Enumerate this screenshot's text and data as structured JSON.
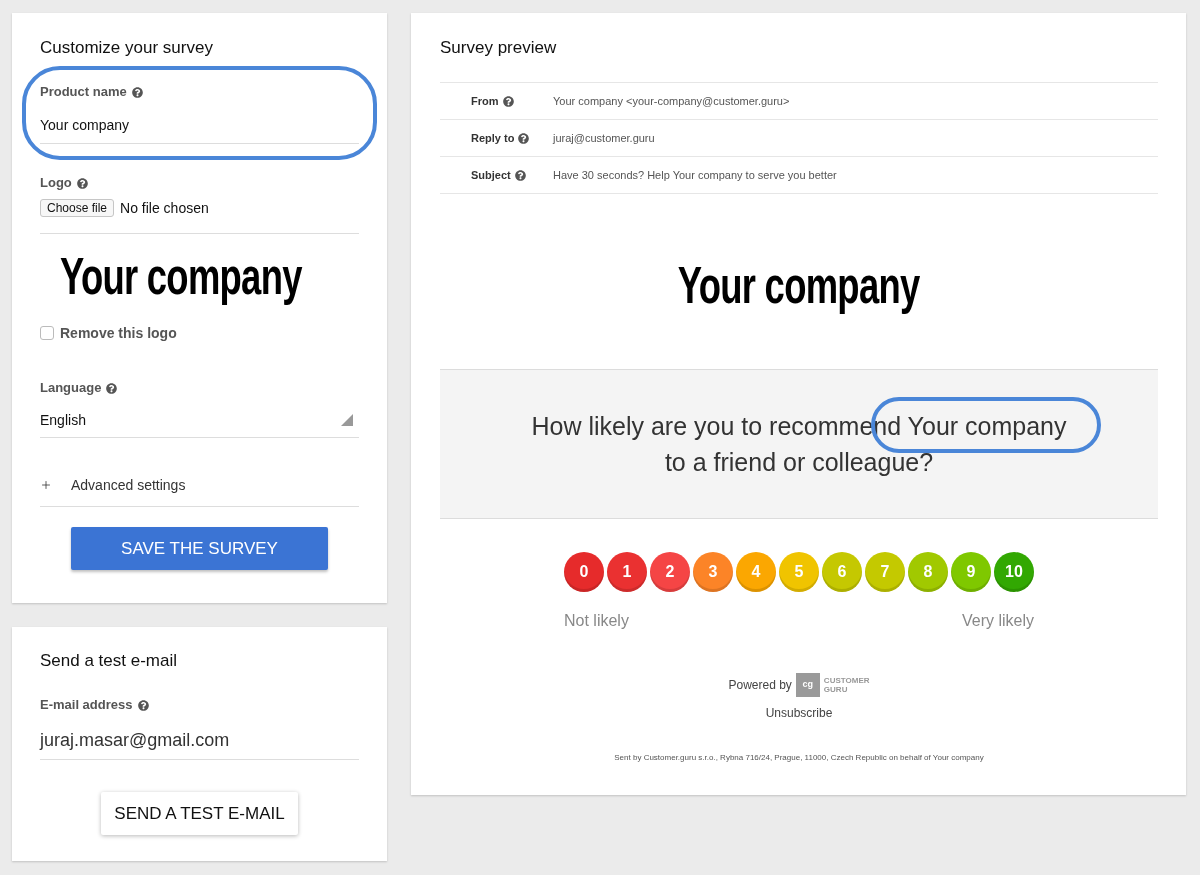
{
  "customize": {
    "title": "Customize your survey",
    "product_name": {
      "label": "Product name",
      "value": "Your company",
      "highlighted": true
    },
    "logo": {
      "label": "Logo",
      "file_button": "Choose file",
      "file_status": "No file chosen",
      "preview_text": "Your company",
      "remove": {
        "label": "Remove this logo",
        "checked": false
      }
    },
    "language": {
      "label": "Language",
      "value": "English"
    },
    "advanced": {
      "label": "Advanced settings",
      "expanded": false
    },
    "save_button": "SAVE THE SURVEY"
  },
  "test_email": {
    "title": "Send a test e-mail",
    "email": {
      "label": "E-mail address",
      "value": "juraj.masar@gmail.com"
    },
    "button": "SEND A TEST E-MAIL"
  },
  "preview": {
    "title": "Survey preview",
    "headers": [
      {
        "label": "From",
        "value": "Your company <your-company@customer.guru>"
      },
      {
        "label": "Reply to",
        "value": "juraj@customer.guru"
      },
      {
        "label": "Subject",
        "value": "Have 30 seconds? Help Your company to serve you better"
      }
    ],
    "logo_text": "Your company",
    "question": {
      "prefix": "How likely are you to recommend",
      "product": "Your company",
      "suffix": "to a friend or colleague?",
      "product_highlighted": true
    },
    "scale": {
      "buttons": [
        {
          "label": "0",
          "color": "#e62b2b"
        },
        {
          "label": "1",
          "color": "#ea3131"
        },
        {
          "label": "2",
          "color": "#f54545"
        },
        {
          "label": "3",
          "color": "#fc8427"
        },
        {
          "label": "4",
          "color": "#fba701"
        },
        {
          "label": "5",
          "color": "#f0c400"
        },
        {
          "label": "6",
          "color": "#c5c801"
        },
        {
          "label": "7",
          "color": "#c4c900"
        },
        {
          "label": "8",
          "color": "#a1c900"
        },
        {
          "label": "9",
          "color": "#7fc800"
        },
        {
          "label": "10",
          "color": "#32a802"
        }
      ],
      "low_label": "Not likely",
      "high_label": "Very likely"
    },
    "footer": {
      "powered_by": "Powered by",
      "brand_mark": "cg",
      "brand_name": "CUSTOMER GURU",
      "unsubscribe": "Unsubscribe",
      "sent_by": "Sent by Customer.guru s.r.o., Rybna 716/24, Prague, 11000, Czech Republic on behalf of Your company"
    }
  }
}
